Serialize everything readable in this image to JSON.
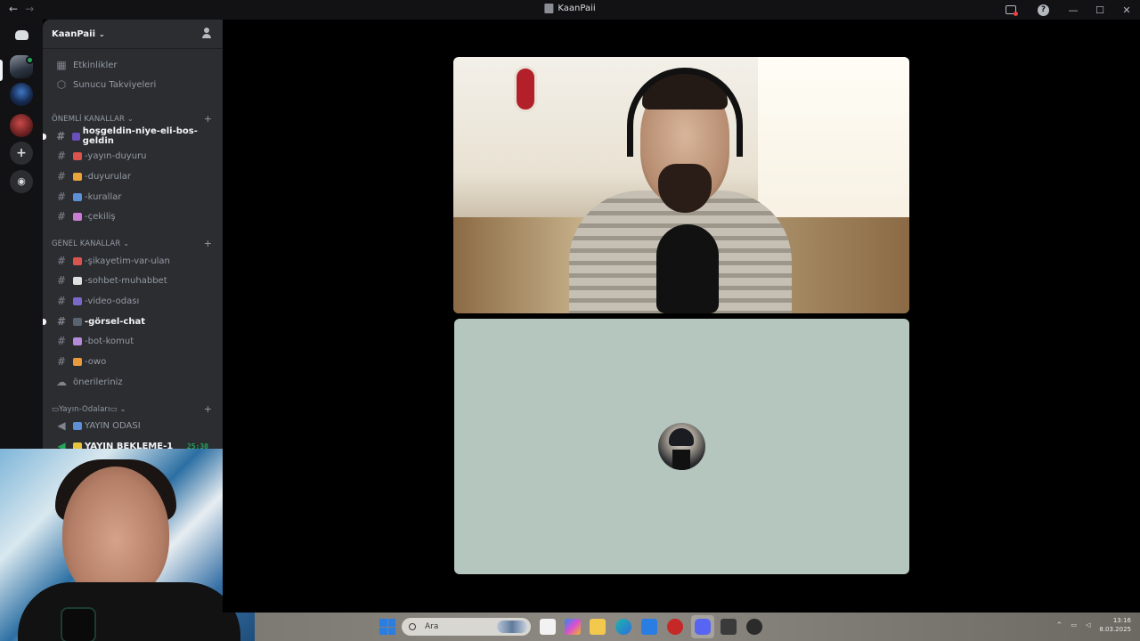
{
  "titlebar": {
    "back": "←",
    "forward": "→",
    "title": "KaanPaii",
    "help": "?",
    "minimize": "—",
    "maximize": "☐",
    "close": "✕"
  },
  "server": {
    "name": "KaanPaii",
    "chevron": "⌵",
    "top_items": [
      {
        "label": "Etkinlikler",
        "icon": "calendar-icon"
      },
      {
        "label": "Sunucu Takviyeleri",
        "icon": "boost-icon"
      }
    ],
    "categories": [
      {
        "label": "ÖNEMLİ KANALLAR",
        "channels": [
          {
            "label": "hoşgeldin-niye-eli-bos-geldin",
            "bold": true,
            "unread": true,
            "emoji_color": "#6b4fbb"
          },
          {
            "label": "-yayın-duyuru",
            "bold": false,
            "unread": false,
            "emoji_color": "#d9534f"
          },
          {
            "label": "-duyurular",
            "bold": false,
            "unread": false,
            "emoji_color": "#e8a33c"
          },
          {
            "label": "-kurallar",
            "bold": false,
            "unread": false,
            "emoji_color": "#5d8fd6"
          },
          {
            "label": "-çekiliş",
            "bold": false,
            "unread": false,
            "emoji_color": "#c77dd4"
          }
        ]
      },
      {
        "label": "GENEL KANALLAR",
        "channels": [
          {
            "label": "-şikayetim-var-ulan",
            "bold": false,
            "unread": false,
            "emoji_color": "#d9534f"
          },
          {
            "label": "-sohbet-muhabbet",
            "bold": false,
            "unread": false,
            "emoji_color": "#e0e0e0"
          },
          {
            "label": "-video-odası",
            "bold": false,
            "unread": false,
            "emoji_color": "#7b68c8"
          },
          {
            "label": "-görsel-chat",
            "bold": true,
            "unread": true,
            "emoji_color": "#5a6470"
          },
          {
            "label": "-bot-komut",
            "bold": false,
            "unread": false,
            "emoji_color": "#b58ad6"
          },
          {
            "label": "-owo",
            "bold": false,
            "unread": false,
            "emoji_color": "#e89a3c"
          },
          {
            "label": "önerileriniz",
            "bold": false,
            "unread": false,
            "emoji_color": ""
          }
        ]
      },
      {
        "label": "Yayın-Odaları",
        "channels": [
          {
            "label": "YAYIN ODASI",
            "bold": false,
            "unread": false,
            "emoji_color": "#5d8fd6"
          },
          {
            "label": "YAYIN BEKLEME-1",
            "bold": true,
            "unread": false,
            "emoji_color": "#e8c33c",
            "timer": "25:30"
          }
        ]
      }
    ]
  },
  "taskbar": {
    "search_placeholder": "Ara",
    "time": "13:16",
    "date": "8.03.2025"
  },
  "colors": {
    "discord_dark": "#121214",
    "sidebar": "#2b2d31",
    "tile_bg": "#b5c6bf",
    "green": "#23a55a"
  }
}
